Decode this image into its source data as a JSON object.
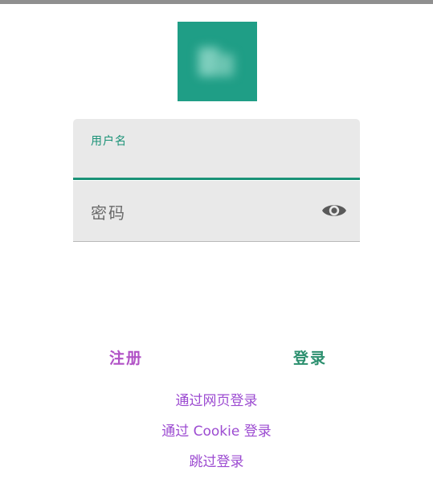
{
  "logo": {
    "icon": "app-logo-icon",
    "color": "#1f9e86"
  },
  "form": {
    "username_label": "用户名",
    "password_placeholder": "密码",
    "accent_color": "#1a9277",
    "toggle_icon": "eye-icon"
  },
  "actions": {
    "register": "注册",
    "login": "登录",
    "register_color": "#b152c6",
    "login_color": "#2b8f6e"
  },
  "links": {
    "web_login": "通过网页登录",
    "cookie_login": "通过 Cookie 登录",
    "skip_login": "跳过登录",
    "color": "#9c4bd1"
  }
}
